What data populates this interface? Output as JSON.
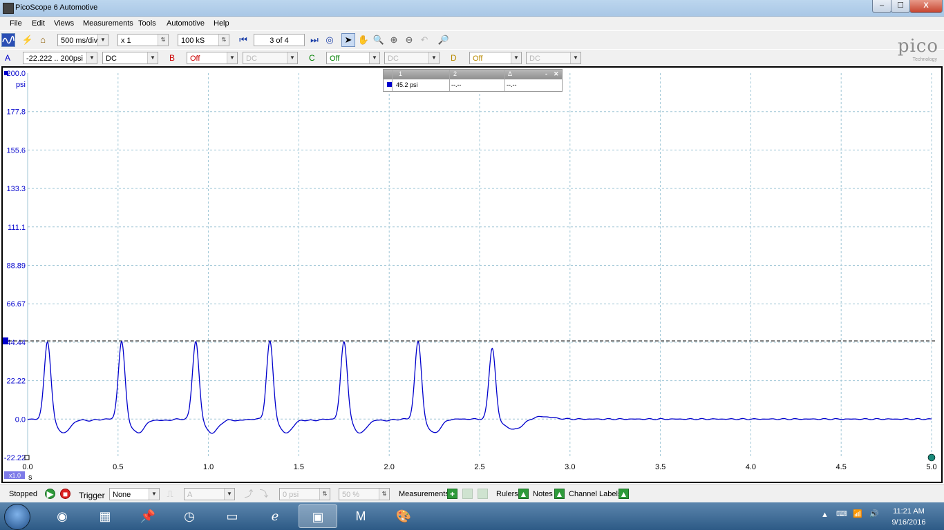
{
  "window": {
    "title": "PicoScope 6 Automotive",
    "min_label": "‒",
    "max_label": "☐",
    "close_label": "X"
  },
  "menu": [
    "File",
    "Edit",
    "Views",
    "Measurements",
    "Tools",
    "Automotive",
    "Help"
  ],
  "toolbar": {
    "timebase": "500 ms/div",
    "zoom_factor": "x 1",
    "samples": "100 kS",
    "buffer": "3 of 4"
  },
  "channels": {
    "a": {
      "letter": "A",
      "range": "-22.222 .. 200psi",
      "coupling": "DC",
      "color": "#0000cc"
    },
    "b": {
      "letter": "B",
      "range": "Off",
      "coupling": "DC",
      "color": "#cc0000"
    },
    "c": {
      "letter": "C",
      "range": "Off",
      "coupling": "DC",
      "color": "#008000"
    },
    "d": {
      "letter": "D",
      "range": "Off",
      "coupling": "DC",
      "color": "#b88a00"
    }
  },
  "logo": {
    "main": "pico",
    "sub": "Technology"
  },
  "rulers_table": {
    "headers": [
      "1",
      "2",
      "Δ"
    ],
    "values": [
      "45.2 psi",
      "--.--",
      "--.--"
    ]
  },
  "chart_data": {
    "type": "line",
    "title": "",
    "xlabel": "s",
    "ylabel": "psi",
    "xlim": [
      0.0,
      5.0
    ],
    "ylim": [
      -22.22,
      200.0
    ],
    "x_ticks": [
      "0.0",
      "0.5",
      "1.0",
      "1.5",
      "2.0",
      "2.5",
      "3.0",
      "3.5",
      "4.0",
      "4.5",
      "5.0"
    ],
    "y_ticks": [
      "200.0",
      "177.8",
      "155.6",
      "133.3",
      "111.1",
      "88.89",
      "66.67",
      "44.44",
      "22.22",
      "0.0",
      "-22.22"
    ],
    "zoom_badge": "x1.0",
    "grid": true,
    "ruler_level": 45.2,
    "series": [
      {
        "color": "#0000cc",
        "peaks": [
          {
            "t": 0.11,
            "v": 45.2
          },
          {
            "t": 0.52,
            "v": 45.2
          },
          {
            "t": 0.93,
            "v": 45.2
          },
          {
            "t": 1.34,
            "v": 45.2
          },
          {
            "t": 1.75,
            "v": 45.2
          },
          {
            "t": 2.16,
            "v": 45.2
          },
          {
            "t": 2.57,
            "v": 41.5
          }
        ],
        "baseline": 0.0,
        "undershoot": -8.0
      }
    ]
  },
  "status": {
    "state": "Stopped",
    "trigger_label": "Trigger",
    "trigger_mode": "None",
    "trigger_channel": "A",
    "trigger_level": "0 psi",
    "pretrigger": "50 %",
    "measurements_label": "Measurements",
    "rulers_label": "Rulers",
    "notes_label": "Notes",
    "channel_labels_label": "Channel Labels"
  },
  "taskbar": {
    "time": "11:21 AM",
    "date": "9/16/2016"
  }
}
